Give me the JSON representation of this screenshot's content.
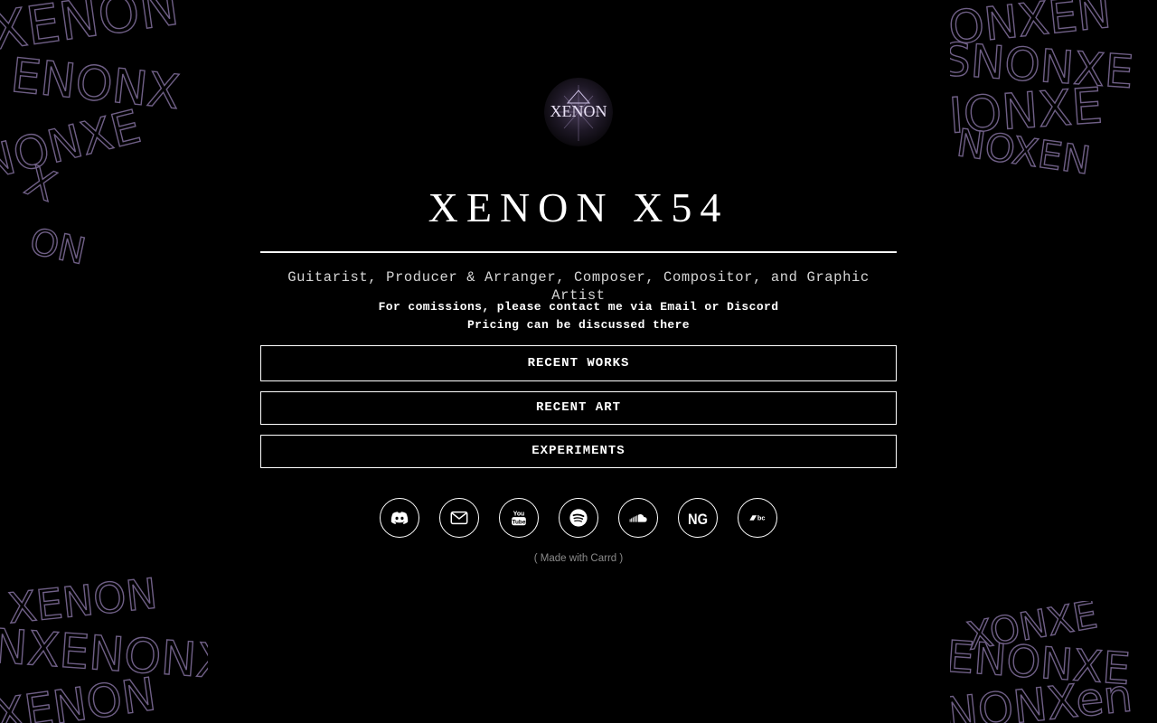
{
  "logo": {
    "text": "XENON"
  },
  "header": {
    "title": "XENON X54"
  },
  "intro": {
    "tagline": "Guitarist, Producer & Arranger, Composer, Compositor, and Graphic Artist",
    "notice_line_1": "For comissions, please contact me via Email or Discord",
    "notice_line_2": "Pricing can be discussed there"
  },
  "buttons": [
    {
      "label": "RECENT WORKS"
    },
    {
      "label": "RECENT ART"
    },
    {
      "label": "EXPERIMENTS"
    }
  ],
  "social_icons": [
    {
      "name": "discord-icon"
    },
    {
      "name": "email-icon"
    },
    {
      "name": "youtube-icon",
      "text": "You Tube"
    },
    {
      "name": "spotify-icon"
    },
    {
      "name": "soundcloud-icon"
    },
    {
      "name": "newgrounds-icon",
      "text": "NG"
    },
    {
      "name": "bandcamp-icon",
      "text": "bc"
    }
  ],
  "footer": {
    "text": "( Made with Carrd )"
  },
  "colors": {
    "background": "#000000",
    "text": "#ffffff",
    "tagline": "#d6d6d6",
    "footer": "#8a8a8a",
    "scribble": "#6f5f86"
  }
}
